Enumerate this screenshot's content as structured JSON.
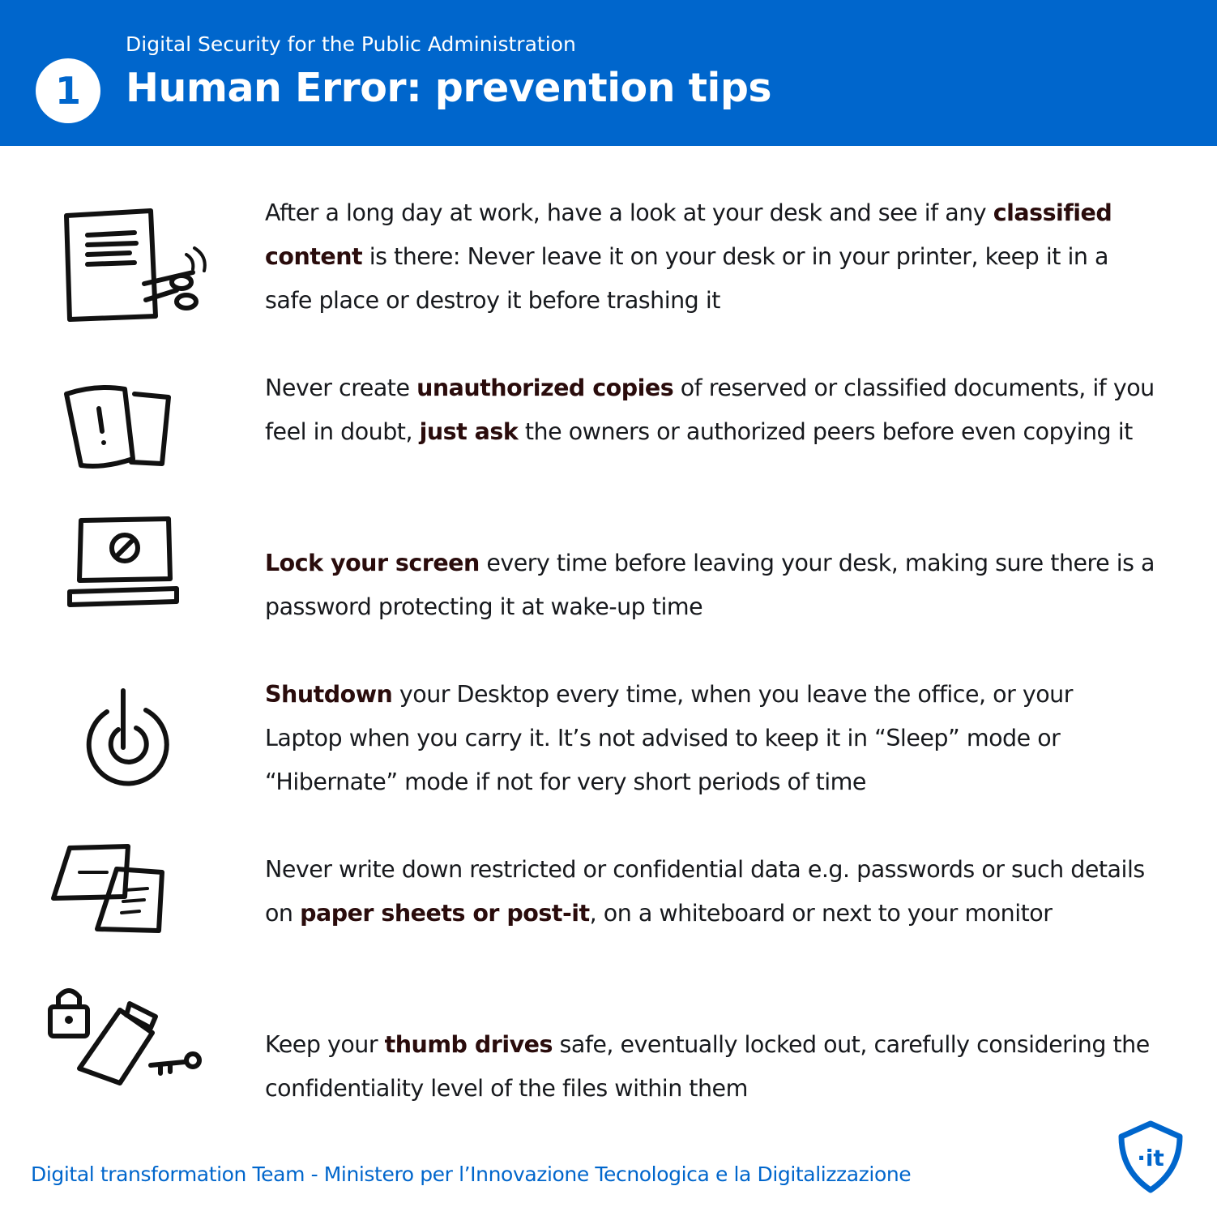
{
  "header": {
    "number": "1",
    "subtitle": "Digital Security for the Public Administration",
    "title": "Human Error: prevention tips",
    "color": "#0066cc"
  },
  "tips": [
    {
      "icon": "shredded-document-icon",
      "parts": [
        {
          "text": "After a long day at work, have a look at your desk and see if any ",
          "bold": false
        },
        {
          "text": "classified content",
          "bold": true
        },
        {
          "text": " is there: Never leave it on your desk or in your printer, keep it in a safe place or destroy it before trashing it",
          "bold": false
        }
      ]
    },
    {
      "icon": "document-copy-warning-icon",
      "parts": [
        {
          "text": "Never create ",
          "bold": false
        },
        {
          "text": "unauthorized copies",
          "bold": true
        },
        {
          "text": " of reserved or classified documents, if you feel in doubt, ",
          "bold": false
        },
        {
          "text": "just ask",
          "bold": true
        },
        {
          "text": " the owners or authorized peers before even copying it",
          "bold": false
        }
      ]
    },
    {
      "icon": "locked-laptop-icon",
      "parts": [
        {
          "text": "Lock your screen",
          "bold": true
        },
        {
          "text": " every time before leaving your desk, making sure there is a password protecting it at wake-up time",
          "bold": false
        }
      ]
    },
    {
      "icon": "power-icon",
      "parts": [
        {
          "text": "Shutdown",
          "bold": true
        },
        {
          "text": " your Desktop every time, when you leave the office, or your Laptop when you carry it. It’s not advised to keep it in “Sleep” mode or “Hibernate” mode if not for very short periods of time",
          "bold": false
        }
      ]
    },
    {
      "icon": "post-it-notes-icon",
      "parts": [
        {
          "text": "Never write down restricted or confidential data e.g. passwords or such details on ",
          "bold": false
        },
        {
          "text": "paper sheets or post-it",
          "bold": true
        },
        {
          "text": ", on a whiteboard or next to your monitor",
          "bold": false
        }
      ]
    },
    {
      "icon": "thumb-drive-lock-key-icon",
      "parts": [
        {
          "text": "Keep your ",
          "bold": false
        },
        {
          "text": "thumb drives",
          "bold": true
        },
        {
          "text": " safe, eventually locked out, carefully considering the confidentiality level of the files within them",
          "bold": false
        }
      ]
    }
  ],
  "footer": {
    "text": "Digital transformation Team - Ministero per l’Innovazione Tecnologica e la Digitalizzazione",
    "logo_text": "·it",
    "logo_icon": "shield-logo-icon"
  }
}
